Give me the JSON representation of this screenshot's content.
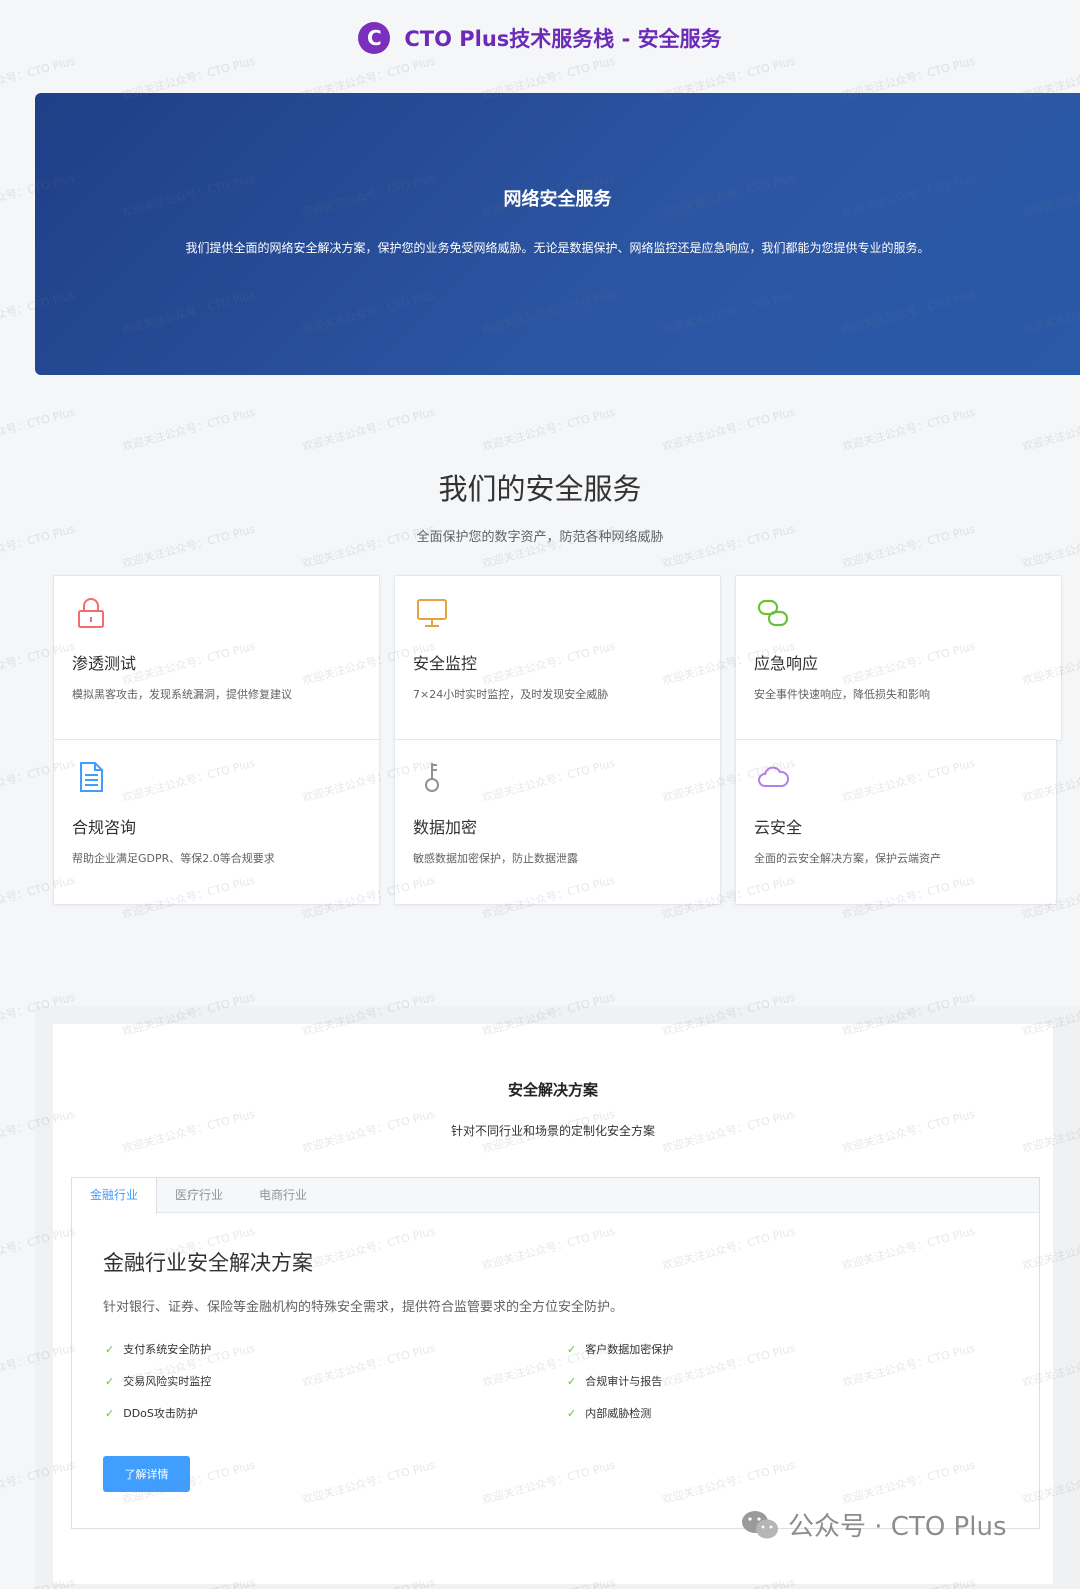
{
  "brand": {
    "logo_letter": "C",
    "title": "CTO Plus技术服务栈 - 安全服务"
  },
  "hero": {
    "title": "网络安全服务",
    "description": "我们提供全面的网络安全解决方案，保护您的业务免受网络威胁。无论是数据保护、网络监控还是应急响应，我们都能为您提供专业的服务。"
  },
  "services": {
    "heading": "我们的安全服务",
    "subheading": "全面保护您的数字资产，防范各种网络威胁",
    "items": [
      {
        "icon": "lock-icon",
        "color": "#f56c6c",
        "title": "渗透测试",
        "desc": "模拟黑客攻击，发现系统漏洞，提供修复建议"
      },
      {
        "icon": "monitor-icon",
        "color": "#e6a23c",
        "title": "安全监控",
        "desc": "7×24小时实时监控，及时发现安全威胁"
      },
      {
        "icon": "link-icon",
        "color": "#67c23a",
        "title": "应急响应",
        "desc": "安全事件快速响应，降低损失和影响"
      },
      {
        "icon": "document-icon",
        "color": "#409eff",
        "title": "合规咨询",
        "desc": "帮助企业满足GDPR、等保2.0等合规要求"
      },
      {
        "icon": "key-icon",
        "color": "#909399",
        "title": "数据加密",
        "desc": "敏感数据加密保护，防止数据泄露"
      },
      {
        "icon": "cloud-icon",
        "color": "#b37feb",
        "title": "云安全",
        "desc": "全面的云安全解决方案，保护云端资产"
      }
    ]
  },
  "solutions": {
    "title": "安全解决方案",
    "subtitle": "针对不同行业和场景的定制化安全方案",
    "tabs": [
      "金融行业",
      "医疗行业",
      "电商行业"
    ],
    "active": {
      "title": "金融行业安全解决方案",
      "desc": "针对银行、证券、保险等金融机构的特殊安全需求，提供符合监管要求的全方位安全防护。",
      "features_left": [
        "支付系统安全防护",
        "交易风险实时监控",
        "DDoS攻击防护"
      ],
      "features_right": [
        "客户数据加密保护",
        "合规审计与报告",
        "内部威胁检测"
      ],
      "button": "了解详情"
    }
  },
  "footer_watermark": "公众号 · CTO Plus",
  "watermark_text": "欢迎关注公众号：CTO Plus",
  "colors": {
    "primary": "#409eff",
    "brand": "#6c2bb6",
    "hero": "#2a4f9a",
    "success": "#67c23a"
  }
}
